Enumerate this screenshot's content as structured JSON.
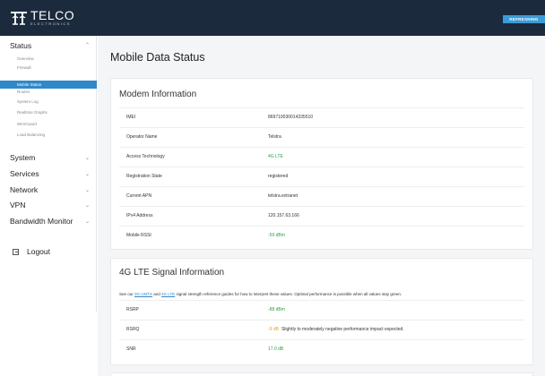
{
  "header": {
    "logo_text": "TELCO",
    "logo_sub": "ELECTRONICS",
    "refresh_label": "REFRESHING"
  },
  "sidebar": {
    "sections": [
      {
        "label": "Status",
        "expanded": true
      },
      {
        "label": "System"
      },
      {
        "label": "Services"
      },
      {
        "label": "Network"
      },
      {
        "label": "VPN"
      },
      {
        "label": "Bandwidth Monitor"
      }
    ],
    "status_items": [
      "Overview",
      "Firewall",
      "Mobile Status",
      "Routes",
      "System Log",
      "Realtime Graphs",
      "WireGuard",
      "Load Balancing"
    ],
    "active_item": "Mobile Status",
    "logout_label": "Logout"
  },
  "main": {
    "title": "Mobile Data Status",
    "modem": {
      "title": "Modem Information",
      "rows": [
        {
          "key": "IMEI",
          "value": "869710030014335510"
        },
        {
          "key": "Operator Name",
          "value": "Telstra"
        },
        {
          "key": "Access Technology",
          "value": "4G LTE"
        },
        {
          "key": "Registration State",
          "value": "registered"
        },
        {
          "key": "Current APN",
          "value": "telstra.extranet"
        },
        {
          "key": "IPv4 Address",
          "value": "120.157.63.166"
        },
        {
          "key": "Mobile RSSI",
          "value": "-59 dBm"
        }
      ]
    },
    "lte": {
      "title": "4G LTE Signal Information",
      "guide_prefix": "See our ",
      "guide_link1": "3G UMTS",
      "guide_and": " and ",
      "guide_link2": "4G LTE",
      "guide_suffix": " signal strength reference guides for how to interpret these values. Optimal performance is possible when all values stay green.",
      "rows": [
        {
          "key": "RSRP",
          "value": "-88 dBm"
        },
        {
          "key": "RSRQ",
          "value": "-9 dB",
          "note": "Slightly to moderately negative performance impact expected."
        },
        {
          "key": "SNR",
          "value": "17.0 dB"
        }
      ]
    }
  },
  "colors": {
    "header_bg": "#1b2a3c",
    "accent": "#2f88c9",
    "refresh_bg": "#3a9bd9",
    "good": "#2e9e3e",
    "warn": "#e5a020"
  }
}
